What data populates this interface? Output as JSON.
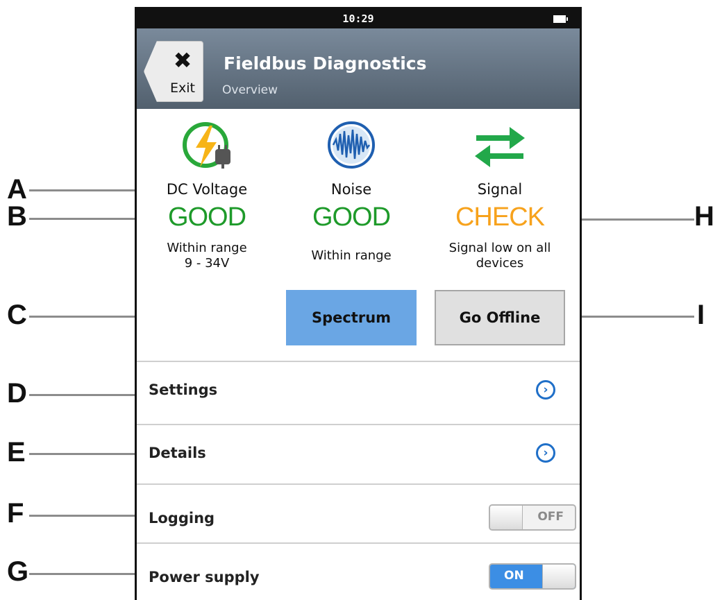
{
  "status_bar": {
    "time": "10:29",
    "battery_icon": "battery-icon"
  },
  "header": {
    "exit_label": "Exit",
    "exit_icon": "close-x-icon",
    "title": "Fieldbus Diagnostics",
    "subtitle": "Overview"
  },
  "metrics": [
    {
      "name": "DC Voltage",
      "state": "GOOD",
      "description_line1": "Within range",
      "description_line2": "9 - 34V",
      "icon": "voltage-plug-icon",
      "state_color": "#1e9a2a"
    },
    {
      "name": "Noise",
      "state": "GOOD",
      "description_line1": "Within range",
      "description_line2": "",
      "icon": "noise-waveform-icon",
      "state_color": "#1e9a2a"
    },
    {
      "name": "Signal",
      "state": "CHECK",
      "description_line1": "Signal low on all",
      "description_line2": "devices",
      "icon": "signal-arrows-icon",
      "state_color": "#f7a21c"
    }
  ],
  "buttons": {
    "spectrum": "Spectrum",
    "go_offline": "Go Offline"
  },
  "rows": {
    "settings": "Settings",
    "details": "Details",
    "logging": {
      "label": "Logging",
      "toggle": "OFF"
    },
    "power_supply": {
      "label": "Power supply",
      "toggle": "ON"
    }
  },
  "callouts": [
    "A",
    "B",
    "C",
    "D",
    "E",
    "F",
    "G",
    "H",
    "I"
  ]
}
